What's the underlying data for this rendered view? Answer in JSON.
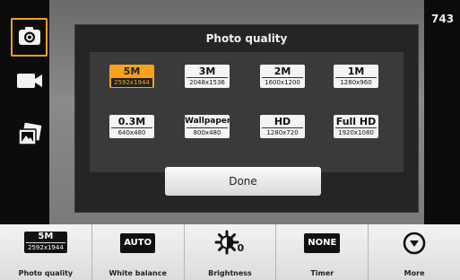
{
  "status": {
    "shots_remaining": "743"
  },
  "mode_bar": {
    "items": [
      {
        "icon": "camera-icon",
        "active": true
      },
      {
        "icon": "video-camera-icon",
        "active": false
      },
      {
        "icon": "gallery-icon",
        "active": false
      }
    ]
  },
  "dialog": {
    "title": "Photo quality",
    "options": [
      {
        "main": "5M",
        "sub": "2592x1944",
        "selected": true
      },
      {
        "main": "3M",
        "sub": "2048x1536",
        "selected": false
      },
      {
        "main": "2M",
        "sub": "1600x1200",
        "selected": false
      },
      {
        "main": "1M",
        "sub": "1280x960",
        "selected": false
      },
      {
        "main": "0.3M",
        "sub": "640x480",
        "selected": false
      },
      {
        "main": "Wallpaper",
        "sub": "800x480",
        "selected": false
      },
      {
        "main": "HD",
        "sub": "1280x720",
        "selected": false
      },
      {
        "main": "Full HD",
        "sub": "1920x1080",
        "selected": false
      }
    ],
    "done_label": "Done"
  },
  "toolbar": {
    "photo_quality": {
      "badge_main": "5M",
      "badge_sub": "2592x1944",
      "label": "Photo quality"
    },
    "white_balance": {
      "badge": "AUTO",
      "label": "White balance"
    },
    "brightness": {
      "icon": "brightness-icon",
      "value": "0",
      "label": "Brightness"
    },
    "timer": {
      "badge": "NONE",
      "label": "Timer"
    },
    "more": {
      "icon": "chevron-down-circle-icon",
      "label": "More"
    }
  },
  "colors": {
    "accent": "#f6a21d",
    "dialog_bg": "#252525",
    "toolbar_bg": "#e6e6e6"
  }
}
